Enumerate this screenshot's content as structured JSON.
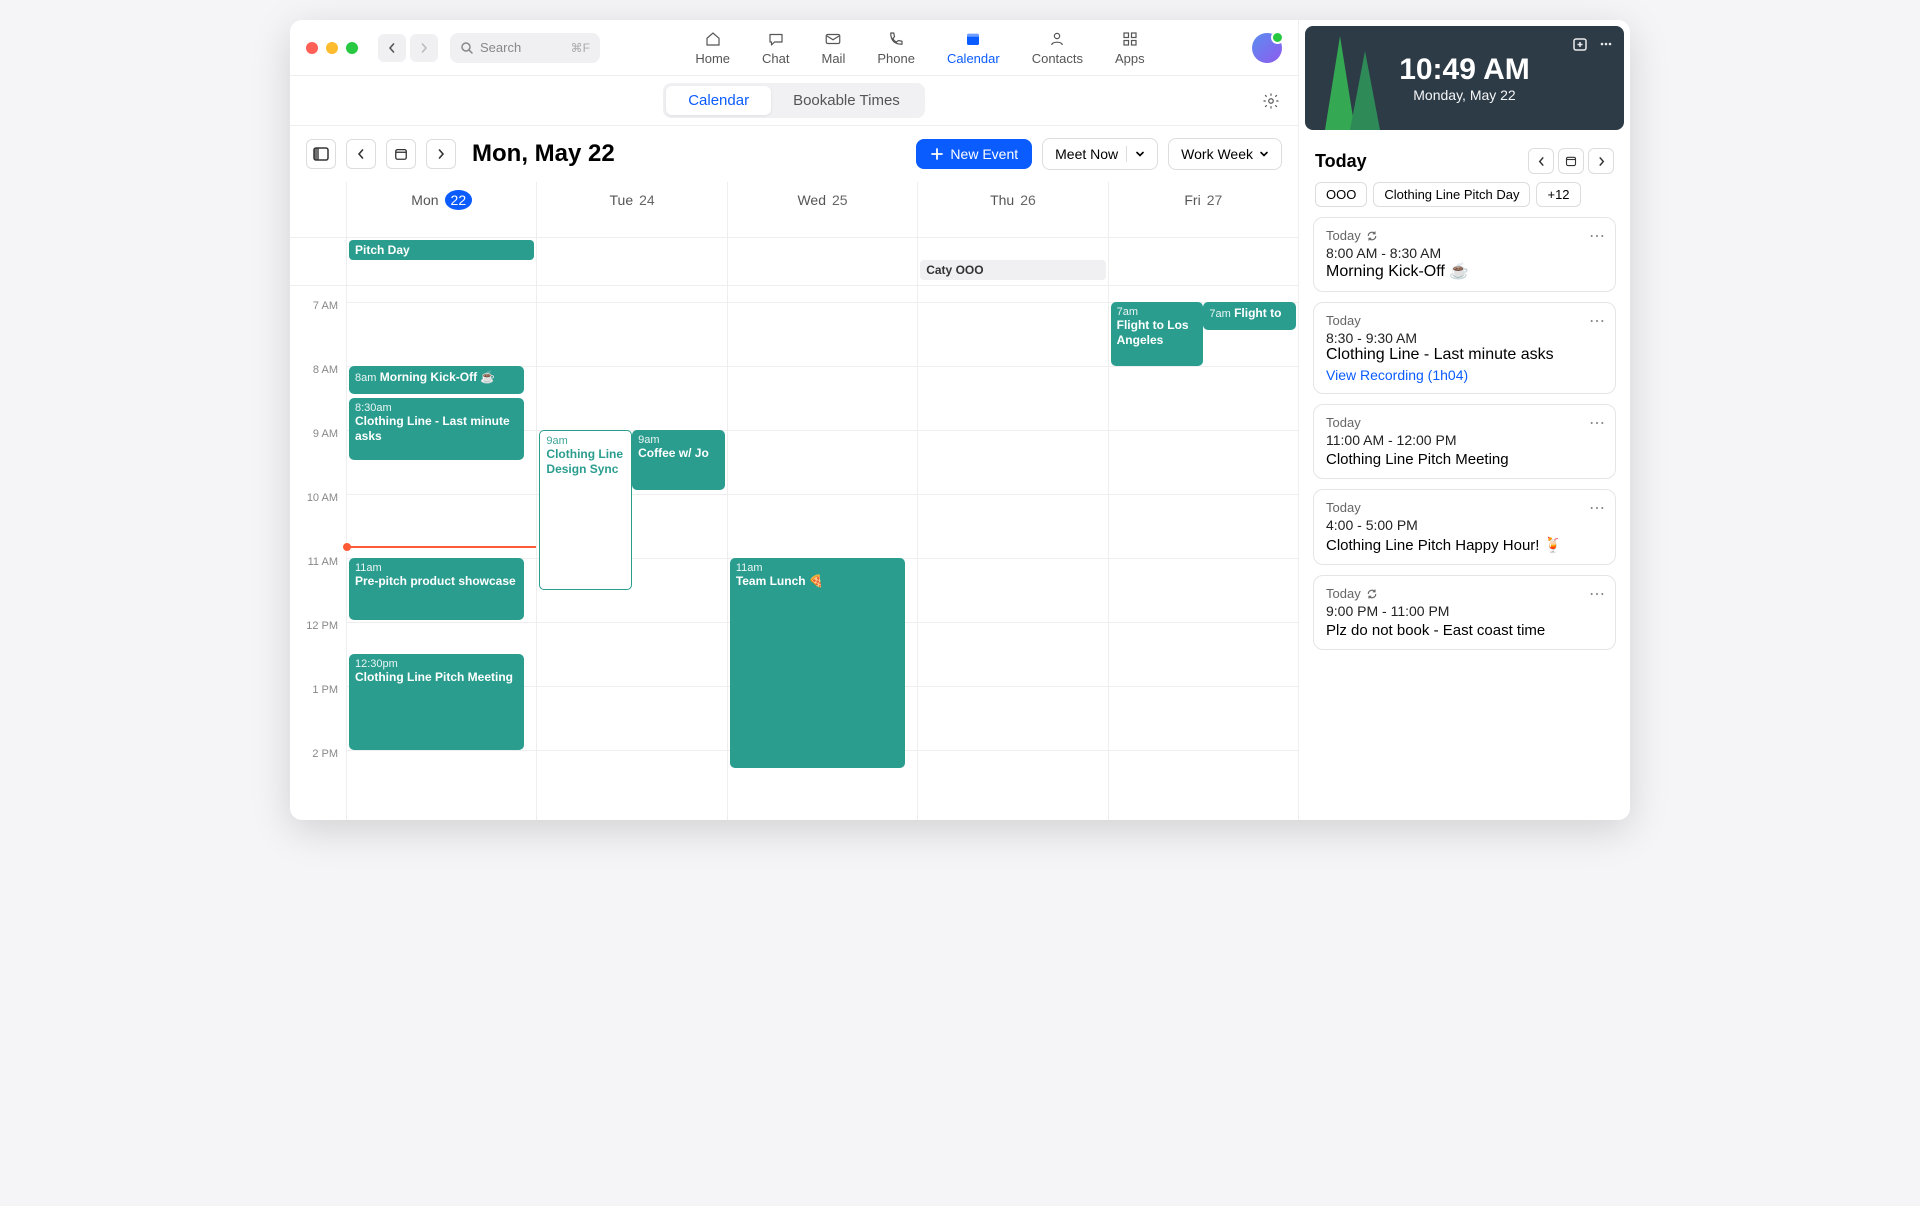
{
  "search": {
    "placeholder": "Search",
    "shortcut": "⌘F"
  },
  "nav": {
    "home": "Home",
    "chat": "Chat",
    "mail": "Mail",
    "phone": "Phone",
    "calendar": "Calendar",
    "contacts": "Contacts",
    "apps": "Apps"
  },
  "segment": {
    "calendar": "Calendar",
    "bookable": "Bookable Times"
  },
  "toolbar": {
    "date": "Mon, May 22",
    "new_event": "New Event",
    "meet_now": "Meet Now",
    "view": "Work Week"
  },
  "days": [
    {
      "name": "Mon",
      "num": "22",
      "today": true
    },
    {
      "name": "Tue",
      "num": "24",
      "today": false
    },
    {
      "name": "Wed",
      "num": "25",
      "today": false
    },
    {
      "name": "Thu",
      "num": "26",
      "today": false
    },
    {
      "name": "Fri",
      "num": "27",
      "today": false
    }
  ],
  "allday": {
    "mon": "Pitch Day",
    "thu": "Caty OOO"
  },
  "hours": [
    "7 AM",
    "8 AM",
    "9 AM",
    "10 AM",
    "11 AM",
    "12 PM",
    "1 PM",
    "2 PM"
  ],
  "events": {
    "mon_kickoff": {
      "time": "8am",
      "title": "Morning Kick-Off ☕"
    },
    "mon_asks": {
      "time": "8:30am",
      "title": "Clothing Line - Last minute asks"
    },
    "mon_prepitch": {
      "time": "11am",
      "title": "Pre-pitch product showcase"
    },
    "mon_pitch": {
      "time": "12:30pm",
      "title": "Clothing Line Pitch Meeting"
    },
    "tue_design": {
      "time": "9am",
      "title": "Clothing Line Design Sync"
    },
    "tue_coffee": {
      "time": "9am",
      "title": "Coffee w/ Jo"
    },
    "wed_lunch": {
      "time": "11am",
      "title": "Team Lunch 🍕"
    },
    "fri_flight1": {
      "time": "7am",
      "title": "Flight to Los Angeles"
    },
    "fri_flight2": {
      "time": "7am",
      "title": "Flight to"
    }
  },
  "clock": {
    "time": "10:49 AM",
    "date": "Monday, May 22"
  },
  "side": {
    "title": "Today",
    "chips": {
      "ooo": "OOO",
      "pitch": "Clothing Line Pitch Day",
      "more": "+12"
    },
    "cards": [
      {
        "label": "Today",
        "recur": true,
        "time": "8:00 AM - 8:30 AM",
        "title": "Morning Kick-Off ☕",
        "link": ""
      },
      {
        "label": "Today",
        "recur": false,
        "time": "8:30 - 9:30 AM",
        "title": "Clothing Line - Last minute asks",
        "link": "View Recording (1h04)"
      },
      {
        "label": "Today",
        "recur": false,
        "time": "11:00 AM - 12:00 PM",
        "title": "Clothing Line Pitch Meeting",
        "link": ""
      },
      {
        "label": "Today",
        "recur": false,
        "time": "4:00 - 5:00 PM",
        "title": "Clothing Line Pitch Happy Hour! 🍹",
        "link": ""
      },
      {
        "label": "Today",
        "recur": true,
        "time": "9:00 PM - 11:00 PM",
        "title": "Plz do not book - East coast time",
        "link": ""
      }
    ]
  }
}
